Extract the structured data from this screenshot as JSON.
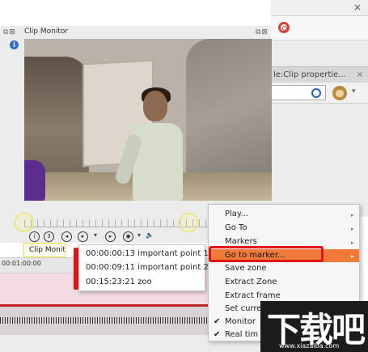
{
  "monitor": {
    "title": "Clip Monitor",
    "tab_label": "Clip Monito"
  },
  "browser": {
    "tab_label": "le:Clip propertie...",
    "close_glyph": "×"
  },
  "timeline": {
    "timecode_partial": "00:01:00:00"
  },
  "marker_menu": {
    "items": [
      "00:00:00:13 important point 1",
      "00:00:09:11 important point 2",
      "00:15:23:21 zoo"
    ]
  },
  "context_menu": {
    "items": [
      "Play...",
      "Go To",
      "Markers",
      "Go to marker...",
      "Save zone",
      "Extract Zone",
      "Extract frame",
      "Set curre",
      "Monitor",
      "Real tim"
    ],
    "checked": [
      "Monitor",
      "Real tim"
    ],
    "highlighted": "Go to marker..."
  },
  "watermark": {
    "brand": "下载吧",
    "url": "www.xiazaiba.com"
  },
  "colors": {
    "highlight": "#ef7a3a",
    "annotation_red": "#e01414",
    "annotation_yellow": "#e6e64a"
  }
}
